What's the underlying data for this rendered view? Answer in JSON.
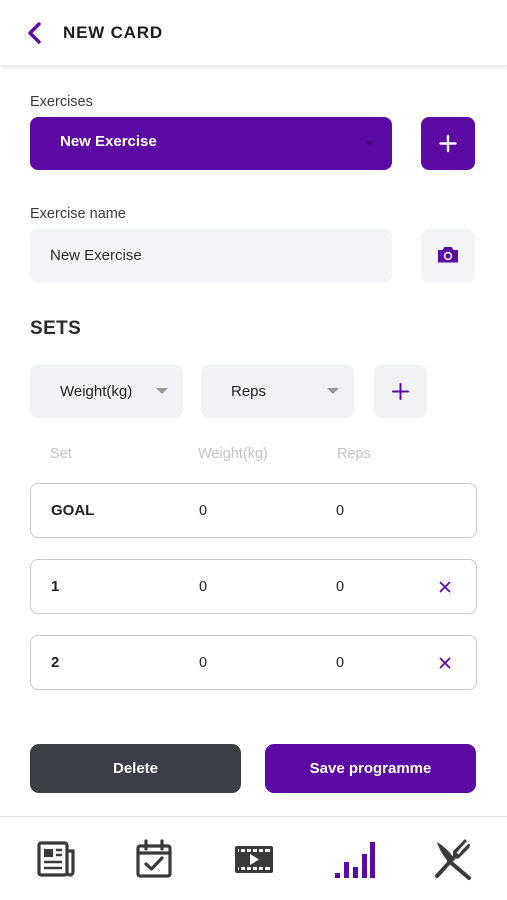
{
  "header": {
    "title": "NEW CARD"
  },
  "exercises": {
    "label": "Exercises",
    "selected": "New Exercise"
  },
  "exercise_name": {
    "label": "Exercise name",
    "value": "New Exercise"
  },
  "sets": {
    "title": "SETS",
    "weight_dropdown": "Weight(kg)",
    "reps_dropdown": "Reps",
    "columns": [
      "Set",
      "Weight(kg)",
      "Reps"
    ],
    "rows": [
      {
        "set": "GOAL",
        "weight": "0",
        "reps": "0"
      },
      {
        "set": "1",
        "weight": "0",
        "reps": "0"
      },
      {
        "set": "2",
        "weight": "0",
        "reps": "0"
      }
    ]
  },
  "actions": {
    "delete": "Delete",
    "save": "Save programme"
  },
  "tabs": [
    {
      "icon": "news-icon"
    },
    {
      "icon": "calendar-check-icon"
    },
    {
      "icon": "video-icon"
    },
    {
      "icon": "bar-chart-icon",
      "active": true
    },
    {
      "icon": "fork-knife-icon"
    }
  ],
  "colors": {
    "accent": "#5b0aa3",
    "dark": "#3b3f45",
    "icon_dark": "#3a3a3a"
  }
}
